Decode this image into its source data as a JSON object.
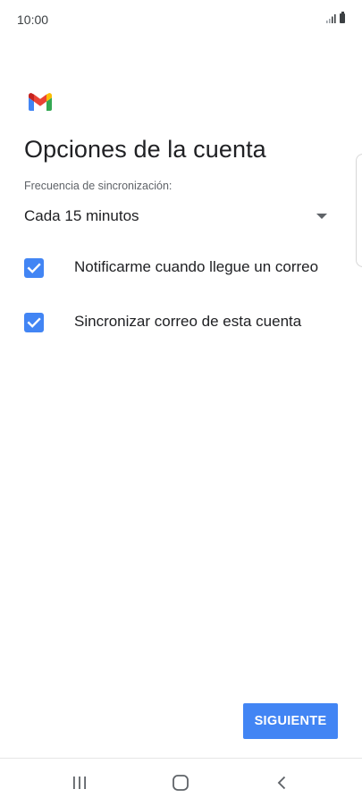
{
  "status_bar": {
    "time": "10:00",
    "icons": [
      "signal-icon",
      "battery-icon"
    ]
  },
  "app": {
    "logo": "gmail-logo",
    "brand_colors": {
      "blue": "#4285F4",
      "red": "#EA4335",
      "yellow": "#FBBC04",
      "green": "#34A853",
      "dark_red": "#C5221F"
    }
  },
  "page": {
    "title": "Opciones de la cuenta"
  },
  "sync": {
    "label": "Frecuencia de sincronización:",
    "selected": "Cada 15 minutos"
  },
  "options": [
    {
      "label": "Notificarme cuando llegue un correo",
      "checked": true
    },
    {
      "label": "Sincronizar correo de esta cuenta",
      "checked": true
    }
  ],
  "actions": {
    "next_label": "SIGUIENTE"
  },
  "nav_bar": {
    "items": [
      "recents-icon",
      "home-icon",
      "back-icon"
    ]
  },
  "colors": {
    "accent": "#4285F4",
    "text_primary": "#202124",
    "text_secondary": "#5F6368",
    "background": "#FFFFFF"
  }
}
